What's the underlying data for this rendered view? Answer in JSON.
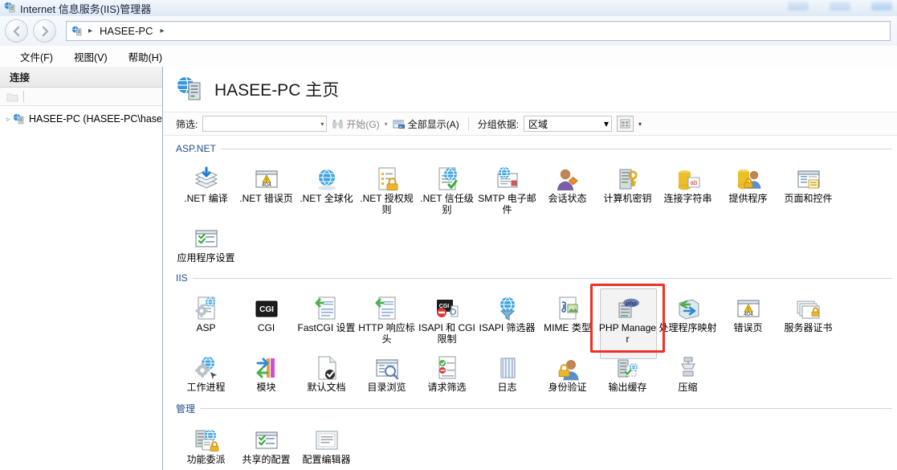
{
  "window": {
    "title": "Internet 信息服务(IIS)管理器",
    "icon": "iis-server-icon"
  },
  "nav": {
    "back_icon": "back-arrow-icon",
    "forward_icon": "forward-arrow-icon",
    "breadcrumb_icon": "server-icon",
    "breadcrumb": "HASEE-PC",
    "arrow": "▸"
  },
  "menu": {
    "items": [
      {
        "label": "文件(F)",
        "name": "menu-file"
      },
      {
        "label": "视图(V)",
        "name": "menu-view"
      },
      {
        "label": "帮助(H)",
        "name": "menu-help"
      }
    ]
  },
  "sidebar": {
    "header": "连接",
    "toolbar_icon": "connect-folder-icon",
    "tree": [
      {
        "label": "HASEE-PC (HASEE-PC\\hase",
        "expander": "▹",
        "icon": "server-node-icon"
      }
    ]
  },
  "main": {
    "page_icon": "server-home-icon",
    "page_title": "HASEE-PC 主页",
    "filter": {
      "label": "筛选:",
      "value": "",
      "placeholder": "",
      "caret": "▾",
      "go_label": "开始(G)",
      "go_icon": "binoculars-icon",
      "go_caret": "▾",
      "showall_label": "全部显示(A)",
      "showall_icon": "show-all-icon",
      "groupby_label": "分组依据:",
      "groupby_value": "区域",
      "groupby_caret": "▾",
      "view_icon": "view-mode-icon",
      "view_caret": "▾"
    },
    "sections": [
      {
        "title": "ASP.NET",
        "name": "section-aspnet",
        "items": [
          {
            "label": ".NET 编译",
            "icon": "net-compilation-icon"
          },
          {
            "label": ".NET 错误页",
            "icon": "net-error-pages-icon"
          },
          {
            "label": ".NET 全球化",
            "icon": "net-globalization-icon"
          },
          {
            "label": ".NET 授权规则",
            "icon": "net-authorization-rules-icon"
          },
          {
            "label": ".NET 信任级别",
            "icon": "net-trust-levels-icon"
          },
          {
            "label": "SMTP 电子邮件",
            "icon": "smtp-email-icon"
          },
          {
            "label": "会话状态",
            "icon": "session-state-icon"
          },
          {
            "label": "计算机密钥",
            "icon": "machine-key-icon"
          },
          {
            "label": "连接字符串",
            "icon": "connection-strings-icon"
          },
          {
            "label": "提供程序",
            "icon": "providers-icon"
          },
          {
            "label": "页面和控件",
            "icon": "pages-and-controls-icon"
          },
          {
            "label": "应用程序设置",
            "icon": "application-settings-icon"
          }
        ]
      },
      {
        "title": "IIS",
        "name": "section-iis",
        "items": [
          {
            "label": "ASP",
            "icon": "asp-icon"
          },
          {
            "label": "CGI",
            "icon": "cgi-icon"
          },
          {
            "label": "FastCGI 设置",
            "icon": "fastcgi-settings-icon"
          },
          {
            "label": "HTTP 响应标头",
            "icon": "http-response-headers-icon"
          },
          {
            "label": "ISAPI 和 CGI 限制",
            "icon": "isapi-cgi-restrictions-icon"
          },
          {
            "label": "ISAPI 筛选器",
            "icon": "isapi-filters-icon"
          },
          {
            "label": "MIME 类型",
            "icon": "mime-types-icon"
          },
          {
            "label": "PHP Manager",
            "icon": "php-manager-icon",
            "selected": true,
            "highlighted": true
          },
          {
            "label": "处理程序映射",
            "icon": "handler-mappings-icon"
          },
          {
            "label": "错误页",
            "icon": "error-pages-icon"
          },
          {
            "label": "服务器证书",
            "icon": "server-certificates-icon"
          },
          {
            "label": "工作进程",
            "icon": "worker-processes-icon"
          },
          {
            "label": "模块",
            "icon": "modules-icon"
          },
          {
            "label": "默认文档",
            "icon": "default-document-icon"
          },
          {
            "label": "目录浏览",
            "icon": "directory-browsing-icon"
          },
          {
            "label": "请求筛选",
            "icon": "request-filtering-icon"
          },
          {
            "label": "日志",
            "icon": "logging-icon"
          },
          {
            "label": "身份验证",
            "icon": "authentication-icon"
          },
          {
            "label": "输出缓存",
            "icon": "output-caching-icon"
          },
          {
            "label": "压缩",
            "icon": "compression-icon"
          }
        ]
      },
      {
        "title": "管理",
        "name": "section-management",
        "items": [
          {
            "label": "功能委派",
            "icon": "feature-delegation-icon"
          },
          {
            "label": "共享的配置",
            "icon": "shared-configuration-icon"
          },
          {
            "label": "配置编辑器",
            "icon": "configuration-editor-icon"
          }
        ]
      }
    ]
  },
  "annotation": {
    "color": "#ee3124",
    "target": "PHP Manager"
  }
}
